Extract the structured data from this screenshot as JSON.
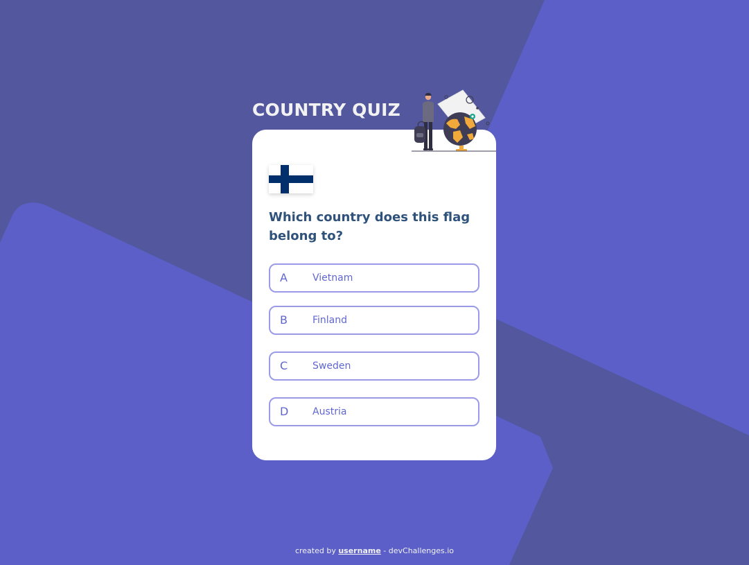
{
  "colors": {
    "background": "#5B5FC7",
    "background_dark": "#52579E",
    "card": "#FFFFFF",
    "title": "#F2F2F2",
    "question": "#2F527B",
    "option_border": "#9A9AE8",
    "option_text": "#6066D0",
    "flag_blue": "#002F6C"
  },
  "app": {
    "title": "COUNTRY QUIZ",
    "illustration_icon": "traveler-with-globe-icon"
  },
  "quiz": {
    "flag": {
      "icon": "finland-flag-icon"
    },
    "question": "Which country does this flag belong to?",
    "options": [
      {
        "letter": "A",
        "answer": "Vietnam"
      },
      {
        "letter": "B",
        "answer": "Finland"
      },
      {
        "letter": "C",
        "answer": "Sweden"
      },
      {
        "letter": "D",
        "answer": "Austria"
      }
    ]
  },
  "footer": {
    "prefix": "created by",
    "username": "username",
    "suffix": "- devChallenges.io"
  }
}
